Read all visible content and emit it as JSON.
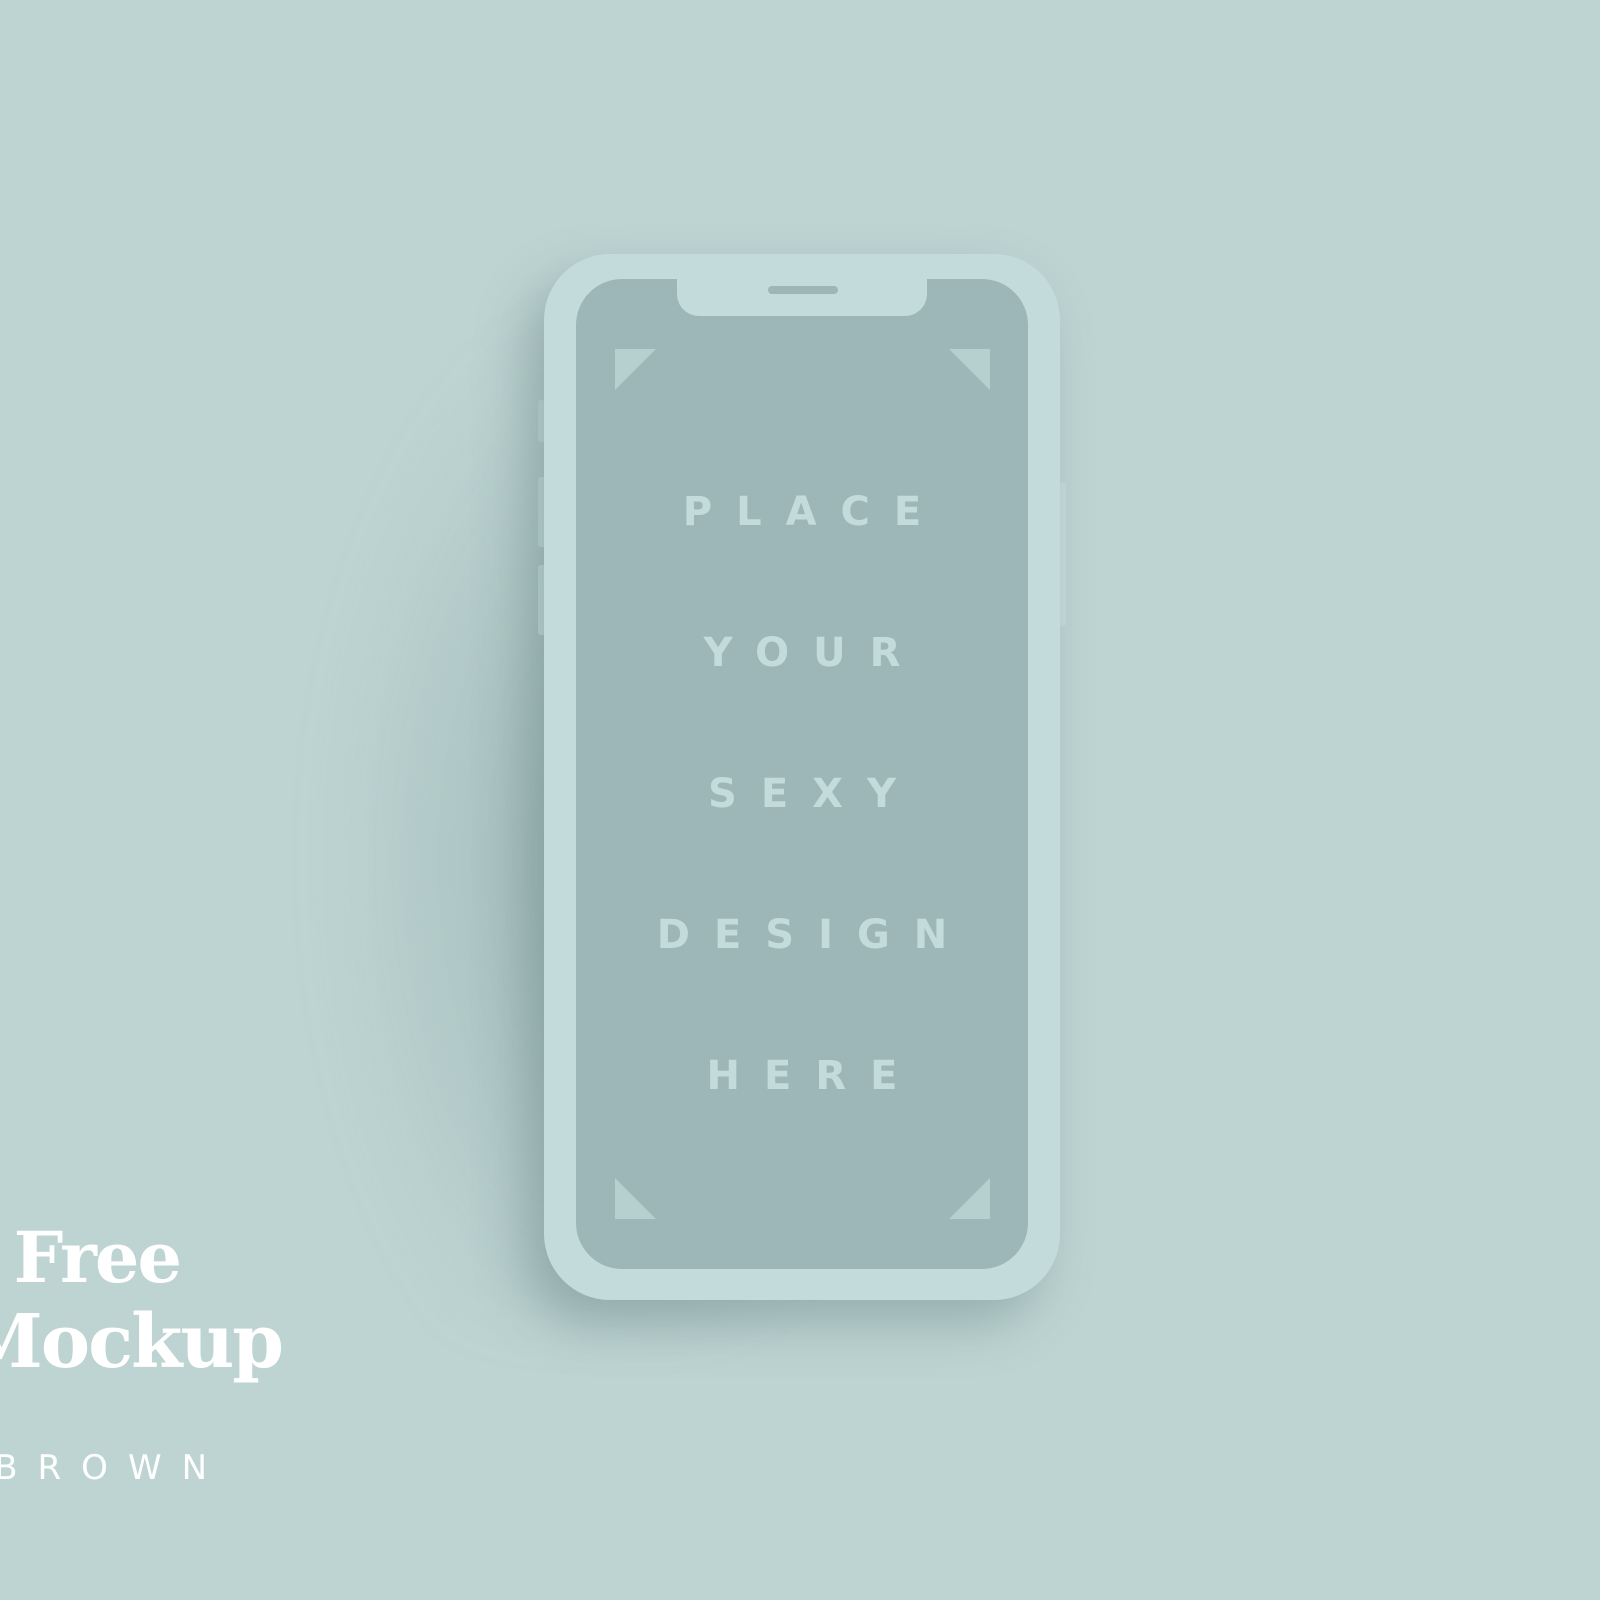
{
  "colors": {
    "background": "#bdd4d2",
    "phone_body": "#c3dbdb",
    "screen": "#9db7b8",
    "text": "#ffffff"
  },
  "phone": {
    "screen_text": [
      "PLACE",
      "YOUR",
      "SEXY",
      "DESIGN",
      "HERE"
    ]
  },
  "promo": {
    "title_line_1": "s Free",
    "title_line_2": "Mockup",
    "byline": "BROWN"
  }
}
